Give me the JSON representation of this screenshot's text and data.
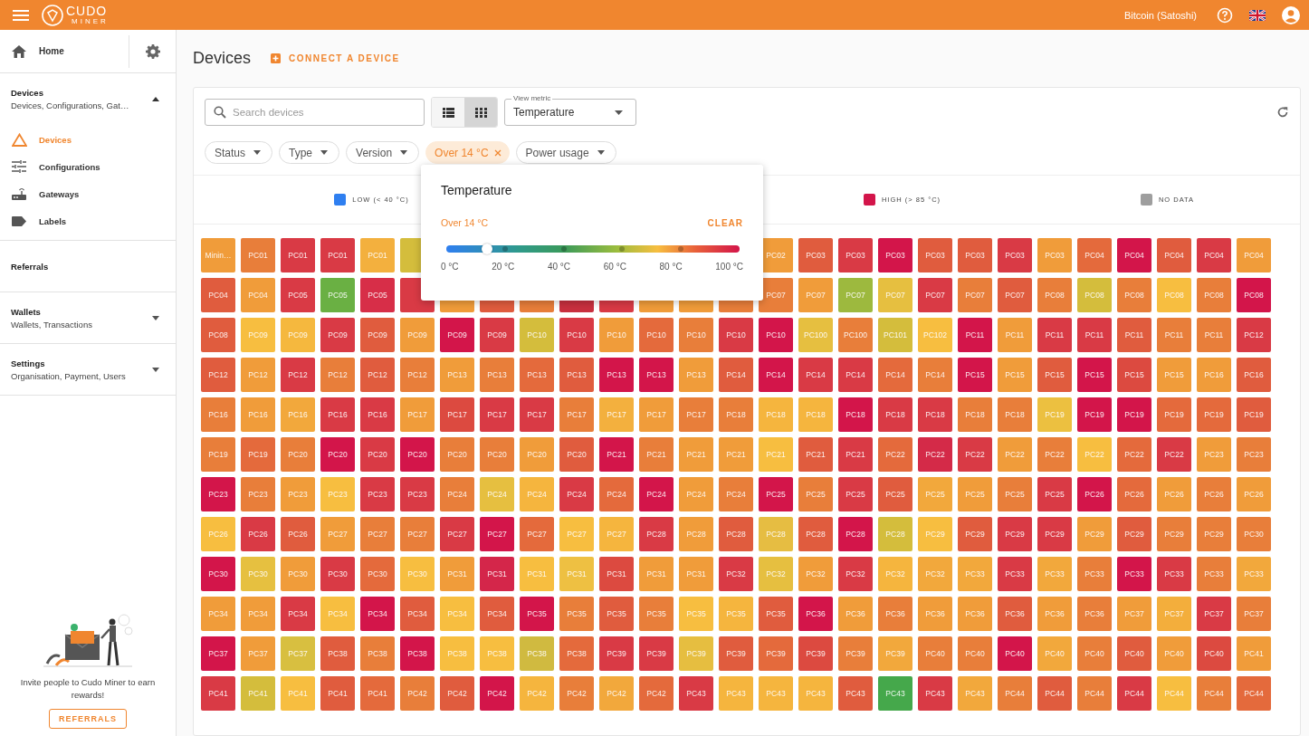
{
  "header": {
    "logo_top": "CUDO",
    "logo_bottom": "MINER",
    "currency": "Bitcoin (Satoshi)"
  },
  "sidebar": {
    "home": "Home",
    "sections": [
      {
        "title": "Devices",
        "subtitle": "Devices, Configurations, Gat…",
        "expanded": true,
        "items": [
          {
            "label": "Devices",
            "kind": "devices",
            "selected": true
          },
          {
            "label": "Configurations",
            "kind": "configurations",
            "selected": false
          },
          {
            "label": "Gateways",
            "kind": "gateways",
            "selected": false
          },
          {
            "label": "Labels",
            "kind": "labels",
            "selected": false
          }
        ]
      },
      {
        "title": "Referrals"
      },
      {
        "title": "Wallets",
        "subtitle": "Wallets, Transactions",
        "expanded": false
      },
      {
        "title": "Settings",
        "subtitle": "Organisation, Payment, Users",
        "expanded": false
      }
    ],
    "invite": {
      "text": "Invite people to Cudo Miner to earn rewards!",
      "button": "REFERRALS"
    }
  },
  "page": {
    "title": "Devices",
    "action": "CONNECT A DEVICE"
  },
  "toolbar": {
    "search_placeholder": "Search devices",
    "views": [
      {
        "kind": "list",
        "selected": false
      },
      {
        "kind": "grid",
        "selected": true
      }
    ],
    "metric_label": "View metric",
    "metric": "Temperature"
  },
  "filters": [
    {
      "label": "Status",
      "active": false
    },
    {
      "label": "Type",
      "active": false
    },
    {
      "label": "Version",
      "active": false
    },
    {
      "label": "Over 14 °C",
      "active": true
    },
    {
      "label": "Power usage",
      "active": false
    }
  ],
  "legend": {
    "before_popup": [
      {
        "label": "LOW (< 40 °C)",
        "color": "#2f7ff0"
      }
    ],
    "after_popup": [
      {
        "label": "HIGH (> 85 °C)",
        "color": "#d3154a"
      },
      {
        "label": "NO DATA",
        "color": "#9e9e9e"
      }
    ]
  },
  "popup": {
    "title": "Temperature",
    "value": "Over 14 °C",
    "clear": "CLEAR",
    "level": 0.14,
    "ticks": [
      "0 °C",
      "20 °C",
      "40 °C",
      "60 °C",
      "80 °C",
      "100 °C"
    ]
  },
  "rows": [
    {
      "tiles": [
        {
          "label": "Minin…",
          "color": "#f09c3a"
        },
        {
          "label": "PC01",
          "color": "#e87e3a"
        },
        {
          "label": "PC01",
          "color": "#d93a45"
        },
        {
          "label": "PC01",
          "color": "#d93a45"
        },
        {
          "label": "PC01",
          "color": "#f3b03e"
        },
        {
          "color": "#d4bd3c"
        }
      ],
      "tiles_after_popup": [
        {
          "label": "PC02",
          "color": "#f09c3a"
        },
        {
          "label": "PC03",
          "color": "#e05c3e"
        },
        {
          "label": "PC03",
          "color": "#d93a45"
        },
        {
          "label": "PC03",
          "color": "#d3154a"
        },
        {
          "label": "PC03",
          "color": "#e05c3e"
        },
        {
          "label": "PC03",
          "color": "#e05c3e"
        },
        {
          "label": "PC03",
          "color": "#d93a45"
        },
        {
          "label": "PC03",
          "color": "#f09c3a"
        },
        {
          "label": "PC04",
          "color": "#e46a3c"
        },
        {
          "label": "PC04",
          "color": "#d3154a"
        },
        {
          "label": "PC04",
          "color": "#e05c3e"
        },
        {
          "label": "PC04",
          "color": "#d93a45"
        },
        {
          "label": "PC04",
          "color": "#f09c3a"
        }
      ]
    },
    {
      "tiles": [
        {
          "label": "PC04",
          "color": "#e05c3e"
        },
        {
          "label": "PC04",
          "color": "#f09c3a"
        },
        {
          "label": "PC05",
          "color": "#d93a45"
        },
        {
          "label": "PC05",
          "color": "#6ab043"
        },
        {
          "label": "PC05",
          "color": "#d72e48"
        },
        {
          "color": "#d93a45"
        },
        {
          "color": "#f09c3a"
        },
        {
          "color": "#e05c3e"
        },
        {
          "color": "#e87e3a"
        },
        {
          "color": "#c9303f"
        },
        {
          "color": "#d93a45"
        },
        {
          "color": "#f09c3a"
        },
        {
          "color": "#f09c3a"
        },
        {
          "color": "#e87e3a"
        },
        {
          "label": "PC07",
          "color": "#e87e3a"
        },
        {
          "label": "PC07",
          "color": "#f09c3a"
        },
        {
          "label": "PC07",
          "color": "#9db93e"
        },
        {
          "label": "PC07",
          "color": "#e6bf40"
        },
        {
          "label": "PC07",
          "color": "#d93a45"
        },
        {
          "label": "PC07",
          "color": "#e87e3a"
        },
        {
          "label": "PC07",
          "color": "#e05c3e"
        },
        {
          "label": "PC08",
          "color": "#e87e3a"
        },
        {
          "label": "PC08",
          "color": "#d4bd3c"
        },
        {
          "label": "PC08",
          "color": "#e87e3a"
        },
        {
          "label": "PC08",
          "color": "#f7be40"
        },
        {
          "label": "PC08",
          "color": "#e87e3a"
        },
        {
          "label": "PC08",
          "color": "#d3154a"
        }
      ]
    },
    {
      "tiles": [
        {
          "label": "PC08",
          "color": "#e05c3e"
        },
        {
          "label": "PC09",
          "color": "#f7be40"
        },
        {
          "label": "PC09",
          "color": "#f5b83e"
        },
        {
          "label": "PC09",
          "color": "#d93a45"
        },
        {
          "label": "PC09",
          "color": "#e05c3e"
        },
        {
          "label": "PC09",
          "color": "#f09c3a"
        },
        {
          "label": "PC09",
          "color": "#d3154a"
        },
        {
          "label": "PC09",
          "color": "#d93a45"
        },
        {
          "label": "PC10",
          "color": "#d4bd3c"
        },
        {
          "label": "PC10",
          "color": "#d93a45"
        },
        {
          "label": "PC10",
          "color": "#f09c3a"
        },
        {
          "label": "PC10",
          "color": "#e46a3c"
        },
        {
          "label": "PC10",
          "color": "#e87e3a"
        },
        {
          "label": "PC10",
          "color": "#d93a45"
        },
        {
          "label": "PC10",
          "color": "#d3154a"
        },
        {
          "label": "PC100",
          "color": "#e6bf40"
        },
        {
          "label": "PC100",
          "color": "#e87e3a"
        },
        {
          "label": "PC101",
          "color": "#d4bd3c"
        },
        {
          "label": "PC102",
          "color": "#f7be40"
        },
        {
          "label": "PC11",
          "color": "#d3154a"
        },
        {
          "label": "PC11",
          "color": "#f09c3a"
        },
        {
          "label": "PC11",
          "color": "#d93a45"
        },
        {
          "label": "PC11",
          "color": "#d93a45"
        },
        {
          "label": "PC11",
          "color": "#e05c3e"
        },
        {
          "label": "PC11",
          "color": "#e87e3a"
        },
        {
          "label": "PC11",
          "color": "#e87e3a"
        },
        {
          "label": "PC12",
          "color": "#d93a45"
        }
      ]
    },
    {
      "tiles": [
        {
          "label": "PC12",
          "color": "#e05c3e"
        },
        {
          "label": "PC12",
          "color": "#f09c3a"
        },
        {
          "label": "PC12",
          "color": "#d93a45"
        },
        {
          "label": "PC12",
          "color": "#e87e3a"
        },
        {
          "label": "PC12",
          "color": "#e05c3e"
        },
        {
          "label": "PC12",
          "color": "#e87e3a"
        },
        {
          "label": "PC13",
          "color": "#f09c3a"
        },
        {
          "label": "PC13",
          "color": "#e87e3a"
        },
        {
          "label": "PC13",
          "color": "#e46a3c"
        },
        {
          "label": "PC13",
          "color": "#e05c3e"
        },
        {
          "label": "PC13",
          "color": "#d3154a"
        },
        {
          "label": "PC13",
          "color": "#d3154a"
        },
        {
          "label": "PC13",
          "color": "#f09c3a"
        },
        {
          "label": "PC14",
          "color": "#e05c3e"
        },
        {
          "label": "PC14",
          "color": "#d3154a"
        },
        {
          "label": "PC14",
          "color": "#d93a45"
        },
        {
          "label": "PC14",
          "color": "#d93a45"
        },
        {
          "label": "PC14",
          "color": "#e46a3c"
        },
        {
          "label": "PC14",
          "color": "#e87e3a"
        },
        {
          "label": "PC15",
          "color": "#d3154a"
        },
        {
          "label": "PC15",
          "color": "#f09c3a"
        },
        {
          "label": "PC15",
          "color": "#e05c3e"
        },
        {
          "label": "PC15",
          "color": "#d3154a"
        },
        {
          "label": "PC15",
          "color": "#dc4a40"
        },
        {
          "label": "PC15",
          "color": "#f09c3a"
        },
        {
          "label": "PC16",
          "color": "#f09c3a"
        },
        {
          "label": "PC16",
          "color": "#e05c3e"
        }
      ]
    },
    {
      "tiles": [
        {
          "label": "PC16",
          "color": "#e87e3a"
        },
        {
          "label": "PC16",
          "color": "#f09c3a"
        },
        {
          "label": "PC16",
          "color": "#f2a83c"
        },
        {
          "label": "PC16",
          "color": "#d93a45"
        },
        {
          "label": "PC16",
          "color": "#d93a45"
        },
        {
          "label": "PC17",
          "color": "#f09c3a"
        },
        {
          "label": "PC17",
          "color": "#dc4a40"
        },
        {
          "label": "PC17",
          "color": "#d93a45"
        },
        {
          "label": "PC17",
          "color": "#d93a45"
        },
        {
          "label": "PC17",
          "color": "#e87e3a"
        },
        {
          "label": "PC17",
          "color": "#f3b03e"
        },
        {
          "label": "PC17",
          "color": "#f09c3a"
        },
        {
          "label": "PC17",
          "color": "#e87e3a"
        },
        {
          "label": "PC18",
          "color": "#e87e3a"
        },
        {
          "label": "PC18",
          "color": "#f5b53e"
        },
        {
          "label": "PC18",
          "color": "#f5b53e"
        },
        {
          "label": "PC18",
          "color": "#d3154a"
        },
        {
          "label": "PC18",
          "color": "#d93a45"
        },
        {
          "label": "PC18",
          "color": "#d93a45"
        },
        {
          "label": "PC18",
          "color": "#e87e3a"
        },
        {
          "label": "PC18",
          "color": "#e87e3a"
        },
        {
          "label": "PC19",
          "color": "#ecc040"
        },
        {
          "label": "PC19",
          "color": "#d3154a"
        },
        {
          "label": "PC19",
          "color": "#d3154a"
        },
        {
          "label": "PC19",
          "color": "#e46a3c"
        },
        {
          "label": "PC19",
          "color": "#e46a3c"
        },
        {
          "label": "PC19",
          "color": "#e05c3e"
        }
      ]
    },
    {
      "tiles": [
        {
          "label": "PC19",
          "color": "#e87e3a"
        },
        {
          "label": "PC19",
          "color": "#e46a3c"
        },
        {
          "label": "PC20",
          "color": "#e87e3a"
        },
        {
          "label": "PC20",
          "color": "#d3154a"
        },
        {
          "label": "PC20",
          "color": "#d93a45"
        },
        {
          "label": "PC20",
          "color": "#d3154a"
        },
        {
          "label": "PC20",
          "color": "#e87e3a"
        },
        {
          "label": "PC20",
          "color": "#e87e3a"
        },
        {
          "label": "PC20",
          "color": "#f09c3a"
        },
        {
          "label": "PC20",
          "color": "#e05c3e"
        },
        {
          "label": "PC21",
          "color": "#d3154a"
        },
        {
          "label": "PC21",
          "color": "#e87e3a"
        },
        {
          "label": "PC21",
          "color": "#f09c3a"
        },
        {
          "label": "PC21",
          "color": "#f09c3a"
        },
        {
          "label": "PC21",
          "color": "#f7be40"
        },
        {
          "label": "PC21",
          "color": "#e05c3e"
        },
        {
          "label": "PC21",
          "color": "#d93a45"
        },
        {
          "label": "PC22",
          "color": "#e46a3c"
        },
        {
          "label": "PC22",
          "color": "#d42a48"
        },
        {
          "label": "PC22",
          "color": "#d93a45"
        },
        {
          "label": "PC22",
          "color": "#f09c3a"
        },
        {
          "label": "PC22",
          "color": "#e87e3a"
        },
        {
          "label": "PC22",
          "color": "#f7be40"
        },
        {
          "label": "PC22",
          "color": "#e46a3c"
        },
        {
          "label": "PC22",
          "color": "#d93a45"
        },
        {
          "label": "PC23",
          "color": "#f09c3a"
        },
        {
          "label": "PC23",
          "color": "#e87e3a"
        }
      ]
    },
    {
      "tiles": [
        {
          "label": "PC23",
          "color": "#d3154a"
        },
        {
          "label": "PC23",
          "color": "#e87e3a"
        },
        {
          "label": "PC23",
          "color": "#f09c3a"
        },
        {
          "label": "PC23",
          "color": "#f7be40"
        },
        {
          "label": "PC23",
          "color": "#d93a45"
        },
        {
          "label": "PC23",
          "color": "#d93a45"
        },
        {
          "label": "PC24",
          "color": "#e87e3a"
        },
        {
          "label": "PC24",
          "color": "#e6bf40"
        },
        {
          "label": "PC24",
          "color": "#f5b53e"
        },
        {
          "label": "PC24",
          "color": "#d93a45"
        },
        {
          "label": "PC24",
          "color": "#e46a3c"
        },
        {
          "label": "PC24",
          "color": "#d3154a"
        },
        {
          "label": "PC24",
          "color": "#f09c3a"
        },
        {
          "label": "PC24",
          "color": "#e87e3a"
        },
        {
          "label": "PC25",
          "color": "#d3154a"
        },
        {
          "label": "PC25",
          "color": "#e87e3a"
        },
        {
          "label": "PC25",
          "color": "#d93a45"
        },
        {
          "label": "PC25",
          "color": "#e05c3e"
        },
        {
          "label": "PC25",
          "color": "#f2a83c"
        },
        {
          "label": "PC25",
          "color": "#f09c3a"
        },
        {
          "label": "PC25",
          "color": "#e87e3a"
        },
        {
          "label": "PC25",
          "color": "#d93a45"
        },
        {
          "label": "PC26",
          "color": "#d3154a"
        },
        {
          "label": "PC26",
          "color": "#e46a3c"
        },
        {
          "label": "PC26",
          "color": "#f09c3a"
        },
        {
          "label": "PC26",
          "color": "#e87e3a"
        },
        {
          "label": "PC26",
          "color": "#f09c3a"
        }
      ]
    },
    {
      "tiles": [
        {
          "label": "PC26",
          "color": "#f7be40"
        },
        {
          "label": "PC26",
          "color": "#d93a45"
        },
        {
          "label": "PC26",
          "color": "#e05c3e"
        },
        {
          "label": "PC27",
          "color": "#f09c3a"
        },
        {
          "label": "PC27",
          "color": "#e87e3a"
        },
        {
          "label": "PC27",
          "color": "#e87e3a"
        },
        {
          "label": "PC27",
          "color": "#d93a45"
        },
        {
          "label": "PC27",
          "color": "#d3154a"
        },
        {
          "label": "PC27",
          "color": "#e46a3c"
        },
        {
          "label": "PC27",
          "color": "#f7be40"
        },
        {
          "label": "PC27",
          "color": "#f5b53e"
        },
        {
          "label": "PC28",
          "color": "#d93a45"
        },
        {
          "label": "PC28",
          "color": "#f09c3a"
        },
        {
          "label": "PC28",
          "color": "#e05c3e"
        },
        {
          "label": "PC28",
          "color": "#e6bd42"
        },
        {
          "label": "PC28",
          "color": "#e05c3e"
        },
        {
          "label": "PC28",
          "color": "#d3154a"
        },
        {
          "label": "PC28",
          "color": "#d4bd3c"
        },
        {
          "label": "PC29",
          "color": "#f7be40"
        },
        {
          "label": "PC29",
          "color": "#e05c3e"
        },
        {
          "label": "PC29",
          "color": "#d93a45"
        },
        {
          "label": "PC29",
          "color": "#d93a45"
        },
        {
          "label": "PC29",
          "color": "#f09c3a"
        },
        {
          "label": "PC29",
          "color": "#e05c3e"
        },
        {
          "label": "PC29",
          "color": "#e87e3a"
        },
        {
          "label": "PC29",
          "color": "#e87e3a"
        },
        {
          "label": "PC30",
          "color": "#e87e3a"
        }
      ]
    },
    {
      "tiles": [
        {
          "label": "PC30",
          "color": "#d3154a"
        },
        {
          "label": "PC30",
          "color": "#e6c040"
        },
        {
          "label": "PC30",
          "color": "#f09c3a"
        },
        {
          "label": "PC30",
          "color": "#d93a45"
        },
        {
          "label": "PC30",
          "color": "#e46a3c"
        },
        {
          "label": "PC30",
          "color": "#f7be40"
        },
        {
          "label": "PC31",
          "color": "#f09c3a"
        },
        {
          "label": "PC31",
          "color": "#d4264a"
        },
        {
          "label": "PC31",
          "color": "#f7be40"
        },
        {
          "label": "PC31",
          "color": "#eec042"
        },
        {
          "label": "PC31",
          "color": "#dc4a40"
        },
        {
          "label": "PC31",
          "color": "#f09c3a"
        },
        {
          "label": "PC31",
          "color": "#f09c3a"
        },
        {
          "label": "PC32",
          "color": "#d93a45"
        },
        {
          "label": "PC32",
          "color": "#e6bf40"
        },
        {
          "label": "PC32",
          "color": "#f09c3a"
        },
        {
          "label": "PC32",
          "color": "#d93a45"
        },
        {
          "label": "PC32",
          "color": "#f5b53e"
        },
        {
          "label": "PC32",
          "color": "#f2a83c"
        },
        {
          "label": "PC33",
          "color": "#f2a83c"
        },
        {
          "label": "PC33",
          "color": "#d93a45"
        },
        {
          "label": "PC33",
          "color": "#f2a83c"
        },
        {
          "label": "PC33",
          "color": "#e87e3a"
        },
        {
          "label": "PC33",
          "color": "#d3154a"
        },
        {
          "label": "PC33",
          "color": "#d93a45"
        },
        {
          "label": "PC33",
          "color": "#e87e3a"
        },
        {
          "label": "PC33",
          "color": "#f2a83c"
        }
      ]
    },
    {
      "tiles": [
        {
          "label": "PC34",
          "color": "#f09c3a"
        },
        {
          "label": "PC34",
          "color": "#f09c3a"
        },
        {
          "label": "PC34",
          "color": "#d93a45"
        },
        {
          "label": "PC34",
          "color": "#f7be40"
        },
        {
          "label": "PC34",
          "color": "#d3154a"
        },
        {
          "label": "PC34",
          "color": "#e05c3e"
        },
        {
          "label": "PC34",
          "color": "#f7be40"
        },
        {
          "label": "PC34",
          "color": "#e05c3e"
        },
        {
          "label": "PC35",
          "color": "#d3154a"
        },
        {
          "label": "PC35",
          "color": "#e87e3a"
        },
        {
          "label": "PC35",
          "color": "#e05c3e"
        },
        {
          "label": "PC35",
          "color": "#e87e3a"
        },
        {
          "label": "PC35",
          "color": "#f7be40"
        },
        {
          "label": "PC35",
          "color": "#f5b53e"
        },
        {
          "label": "PC35",
          "color": "#e05c3e"
        },
        {
          "label": "PC36",
          "color": "#d3154a"
        },
        {
          "label": "PC36",
          "color": "#f09c3a"
        },
        {
          "label": "PC36",
          "color": "#e87e3a"
        },
        {
          "label": "PC36",
          "color": "#f09c3a"
        },
        {
          "label": "PC36",
          "color": "#f09c3a"
        },
        {
          "label": "PC36",
          "color": "#e05c3e"
        },
        {
          "label": "PC36",
          "color": "#f09c3a"
        },
        {
          "label": "PC36",
          "color": "#e87e3a"
        },
        {
          "label": "PC37",
          "color": "#f09c3a"
        },
        {
          "label": "PC37",
          "color": "#f3ae3c"
        },
        {
          "label": "PC37",
          "color": "#d93a45"
        },
        {
          "label": "PC37",
          "color": "#e87e3a"
        }
      ]
    },
    {
      "tiles": [
        {
          "label": "PC37",
          "color": "#d3154a"
        },
        {
          "label": "PC37",
          "color": "#f09c3a"
        },
        {
          "label": "PC37",
          "color": "#d8bf40"
        },
        {
          "label": "PC38",
          "color": "#e05c3e"
        },
        {
          "label": "PC38",
          "color": "#e87e3a"
        },
        {
          "label": "PC38",
          "color": "#d3154a"
        },
        {
          "label": "PC38",
          "color": "#f7be40"
        },
        {
          "label": "PC38",
          "color": "#f7be40"
        },
        {
          "label": "PC38",
          "color": "#d0ba40"
        },
        {
          "label": "PC38",
          "color": "#e46a3c"
        },
        {
          "label": "PC39",
          "color": "#d93a45"
        },
        {
          "label": "PC39",
          "color": "#d93a45"
        },
        {
          "label": "PC39",
          "color": "#e6be40"
        },
        {
          "label": "PC39",
          "color": "#e05c3e"
        },
        {
          "label": "PC39",
          "color": "#e46a3c"
        },
        {
          "label": "PC39",
          "color": "#dc4a40"
        },
        {
          "label": "PC39",
          "color": "#e87e3a"
        },
        {
          "label": "PC39",
          "color": "#f2a83c"
        },
        {
          "label": "PC40",
          "color": "#e87e3a"
        },
        {
          "label": "PC40",
          "color": "#e87e3a"
        },
        {
          "label": "PC40",
          "color": "#d3154a"
        },
        {
          "label": "PC40",
          "color": "#f2a83c"
        },
        {
          "label": "PC40",
          "color": "#e87e3a"
        },
        {
          "label": "PC40",
          "color": "#e05c3e"
        },
        {
          "label": "PC40",
          "color": "#f09c3a"
        },
        {
          "label": "PC40",
          "color": "#dc4a40"
        },
        {
          "label": "PC41",
          "color": "#f09c3a"
        }
      ]
    },
    {
      "tiles": [
        {
          "label": "PC41",
          "color": "#d93a45"
        },
        {
          "label": "PC41",
          "color": "#d4bd3c"
        },
        {
          "label": "PC41",
          "color": "#f7be40"
        },
        {
          "label": "PC41",
          "color": "#e05c3e"
        },
        {
          "label": "PC41",
          "color": "#e46a3c"
        },
        {
          "label": "PC42",
          "color": "#e87e3a"
        },
        {
          "label": "PC42",
          "color": "#e05c3e"
        },
        {
          "label": "PC42",
          "color": "#d3154a"
        },
        {
          "label": "PC42",
          "color": "#f5b53e"
        },
        {
          "label": "PC42",
          "color": "#e87e3a"
        },
        {
          "label": "PC42",
          "color": "#f2a83c"
        },
        {
          "label": "PC42",
          "color": "#e46a3c"
        },
        {
          "label": "PC43",
          "color": "#d93a45"
        },
        {
          "label": "PC43",
          "color": "#f5b53e"
        },
        {
          "label": "PC43",
          "color": "#f5b53e"
        },
        {
          "label": "PC43",
          "color": "#f5b53e"
        },
        {
          "label": "PC43",
          "color": "#e05c3e"
        },
        {
          "label": "PC43",
          "color": "#45a84b"
        },
        {
          "label": "PC43",
          "color": "#d93a45"
        },
        {
          "label": "PC43",
          "color": "#f2a83c"
        },
        {
          "label": "PC44",
          "color": "#e87e3a"
        },
        {
          "label": "PC44",
          "color": "#e05c3e"
        },
        {
          "label": "PC44",
          "color": "#e87e3a"
        },
        {
          "label": "PC44",
          "color": "#d93a45"
        },
        {
          "label": "PC44",
          "color": "#f7be40"
        },
        {
          "label": "PC44",
          "color": "#e87e3a"
        },
        {
          "label": "PC44",
          "color": "#e46a3c"
        }
      ]
    }
  ]
}
